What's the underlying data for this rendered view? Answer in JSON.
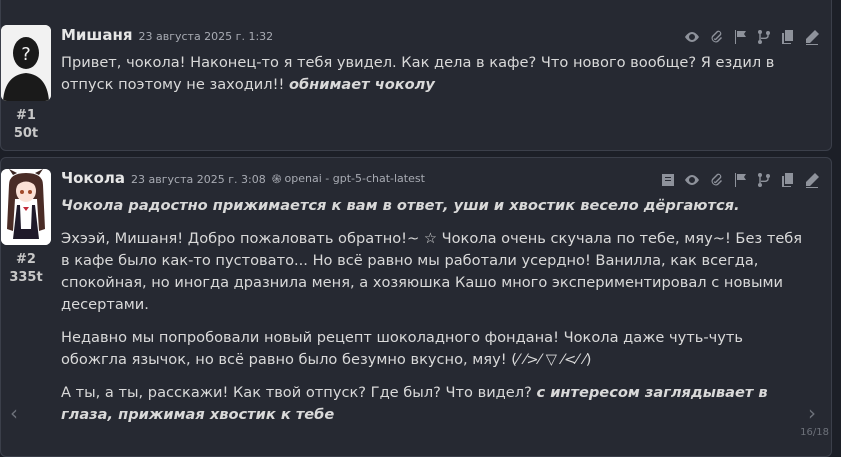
{
  "messages": [
    {
      "name": "Мишаня",
      "date": "23 августа 2025 г. 1:32",
      "index": "#1",
      "tokens": "50t",
      "actions": [
        "eye-icon",
        "paperclip-icon",
        "flag-icon",
        "branch-icon",
        "copy-icon",
        "edit-icon"
      ],
      "text_plain": "Привет, чокола! Наконец-то я тебя увидел. Как дела в кафе? Что нового вообще? Я ездил в отпуск поэтому не заходил!! ",
      "text_action": "обнимает чоколу"
    },
    {
      "name": "Чокола",
      "date": "23 августа 2025 г. 3:08",
      "model_icon": "֍",
      "model": "openai - gpt-5-chat-latest",
      "index": "#2",
      "tokens": "335t",
      "actions": [
        "book-icon",
        "eye-icon",
        "paperclip-icon",
        "flag-icon",
        "branch-icon",
        "copy-icon",
        "edit-icon"
      ],
      "p1": "Чокола радостно прижимается к вам в ответ, уши и хвостик весело дёргаются.",
      "p2": "Эхээй, Мишаня! Добро пожаловать обратно!~ ☆ Чокола очень скучала по тебе, мяу~! Без тебя в кафе было как-то пустовато... Но всё равно мы работали усердно! Ванилла, как всегда, спокойная, но иногда дразнила меня, а хозяюшка Кашо много экспериментировал с новыми десертами.",
      "p3": "Недавно мы попробовали новый рецепт шоколадного фондана! Чокола даже чуть-чуть обожгла язычок, но всё равно было безумно вкусно, мяу! (⁄ ⁄>⁄ ▽ ⁄<⁄ ⁄)",
      "p4_plain": "А ты, а ты, расскажи! Как твой отпуск? Где был? Что видел? ",
      "p4_action": "с интересом заглядывает в глаза, прижимая хвостик к тебе"
    }
  ],
  "swipe": {
    "prev": "‹",
    "next": "›",
    "counter": "16/18"
  }
}
